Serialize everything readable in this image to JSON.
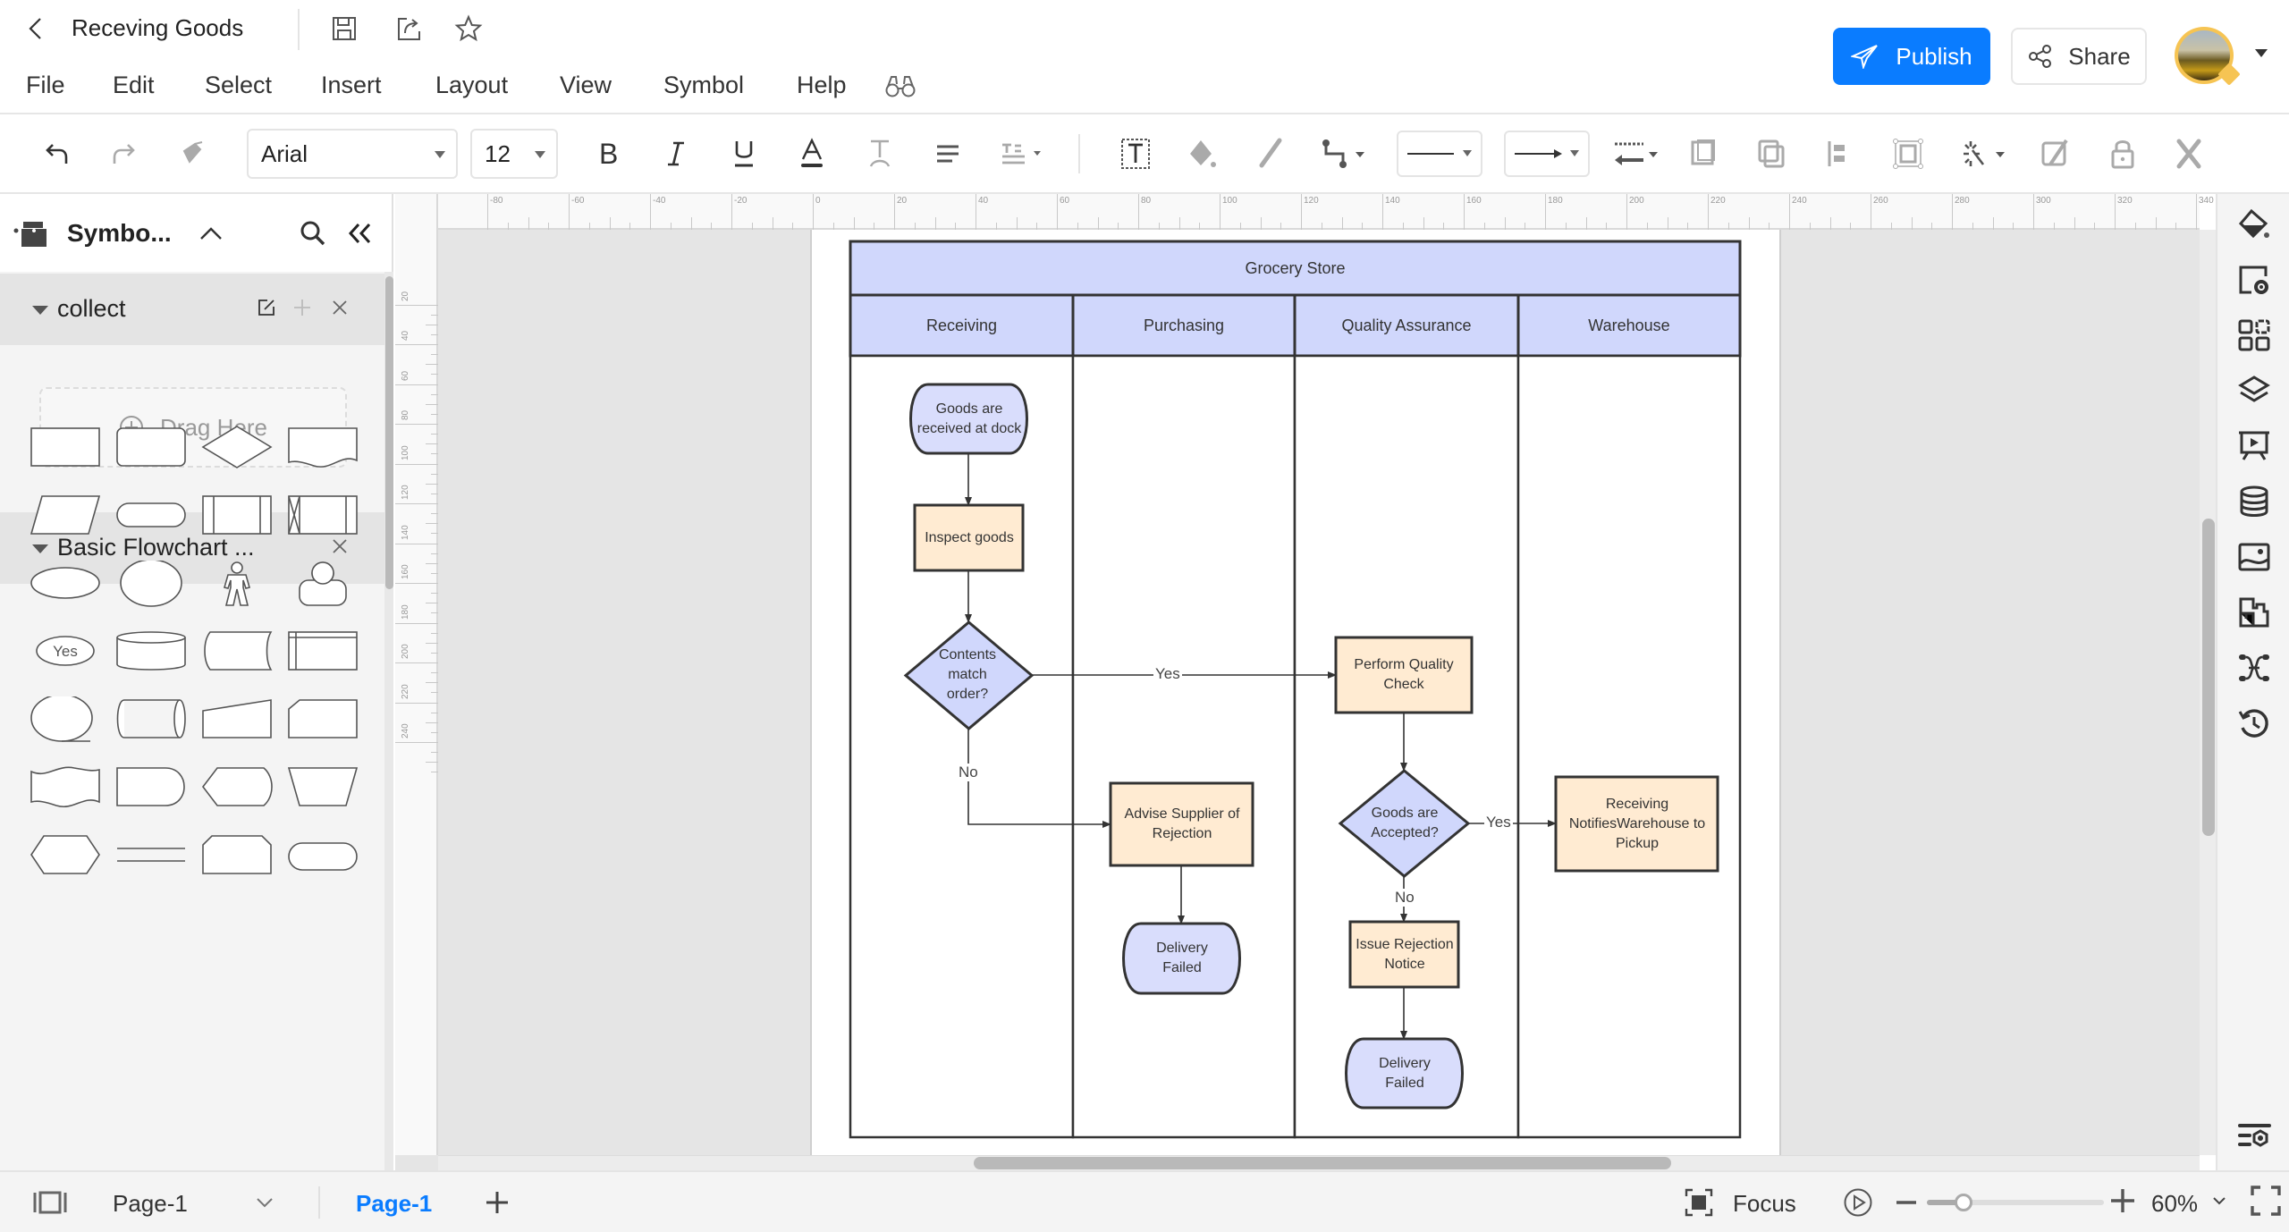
{
  "app": {
    "document_title": "Receving Goods",
    "publish_label": "Publish",
    "share_label": "Share"
  },
  "menu": [
    "File",
    "Edit",
    "Select",
    "Insert",
    "Layout",
    "View",
    "Symbol",
    "Help"
  ],
  "toolbar": {
    "font_family": "Arial",
    "font_size": "12"
  },
  "left_panel": {
    "title": "Symbo...",
    "sections": [
      {
        "label": "collect",
        "drag_placeholder": "Drag Here"
      },
      {
        "label": "Basic Flowchart ..."
      }
    ],
    "shapes": [
      "process",
      "rounded-rectangle",
      "decision",
      "document",
      "data",
      "terminator",
      "predefined-process",
      "internal-storage-x",
      "ellipse",
      "circle",
      "actor",
      "user",
      "yes-label",
      "database",
      "stored-data",
      "internal-storage",
      "sequential-data",
      "direct-data",
      "manual-input",
      "card",
      "punched-tape",
      "delay",
      "display",
      "manual-operation",
      "preparation",
      "parallel-mode",
      "loop-limit",
      "terminator-2"
    ],
    "yes_shape_text": "Yes"
  },
  "rulers": {
    "horizontal": [
      "-80",
      "-60",
      "-40",
      "-20",
      "0",
      "20",
      "40",
      "60",
      "80",
      "100",
      "120",
      "140",
      "160",
      "180",
      "200",
      "220",
      "240",
      "260",
      "280",
      "300",
      "320",
      "340"
    ],
    "vertical": [
      "20",
      "40",
      "60",
      "80",
      "100",
      "120",
      "140",
      "160",
      "180",
      "200",
      "220",
      "240"
    ]
  },
  "diagram": {
    "pool_title": "Grocery Store",
    "lanes": [
      "Receiving",
      "Purchasing",
      "Quality Assurance",
      "Warehouse"
    ],
    "colors": {
      "header_fill": "#d0d7fc",
      "process_fill": "#ffebd2",
      "decision_fill": "#d0d7fc",
      "terminator_fill": "#d9ddfc",
      "stroke": "#333333"
    },
    "nodes": [
      {
        "id": "start",
        "type": "terminator",
        "lane": "Receiving",
        "text": "Goods are received at dock"
      },
      {
        "id": "inspect",
        "type": "process",
        "lane": "Receiving",
        "text": "Inspect goods"
      },
      {
        "id": "match",
        "type": "decision",
        "lane": "Receiving",
        "text": "Contents match order?"
      },
      {
        "id": "qc",
        "type": "process",
        "lane": "Quality Assurance",
        "text": "Perform Quality Check"
      },
      {
        "id": "advise",
        "type": "process",
        "lane": "Purchasing",
        "text": "Advise Supplier of Rejection"
      },
      {
        "id": "accepted",
        "type": "decision",
        "lane": "Quality Assurance",
        "text": "Goods are Accepted?"
      },
      {
        "id": "notify",
        "type": "process",
        "lane": "Warehouse",
        "text": "Receiving NotifiesWarehouse to Pickup"
      },
      {
        "id": "issue",
        "type": "process",
        "lane": "Quality Assurance",
        "text": "Issue Rejection Notice"
      },
      {
        "id": "failed1",
        "type": "terminator",
        "lane": "Purchasing",
        "text": "Delivery Failed"
      },
      {
        "id": "failed2",
        "type": "terminator",
        "lane": "Quality Assurance",
        "text": "Delivery Failed"
      }
    ],
    "edges": [
      {
        "from": "start",
        "to": "inspect",
        "label": ""
      },
      {
        "from": "inspect",
        "to": "match",
        "label": ""
      },
      {
        "from": "match",
        "to": "qc",
        "label": "Yes"
      },
      {
        "from": "match",
        "to": "advise",
        "label": "No"
      },
      {
        "from": "advise",
        "to": "failed1",
        "label": ""
      },
      {
        "from": "qc",
        "to": "accepted",
        "label": ""
      },
      {
        "from": "accepted",
        "to": "notify",
        "label": "Yes"
      },
      {
        "from": "accepted",
        "to": "issue",
        "label": "No"
      },
      {
        "from": "issue",
        "to": "failed2",
        "label": ""
      }
    ]
  },
  "status_bar": {
    "page_selector": "Page-1",
    "active_page_tab": "Page-1",
    "focus_label": "Focus",
    "zoom_level": "60%",
    "zoom_fraction": 0.6
  }
}
